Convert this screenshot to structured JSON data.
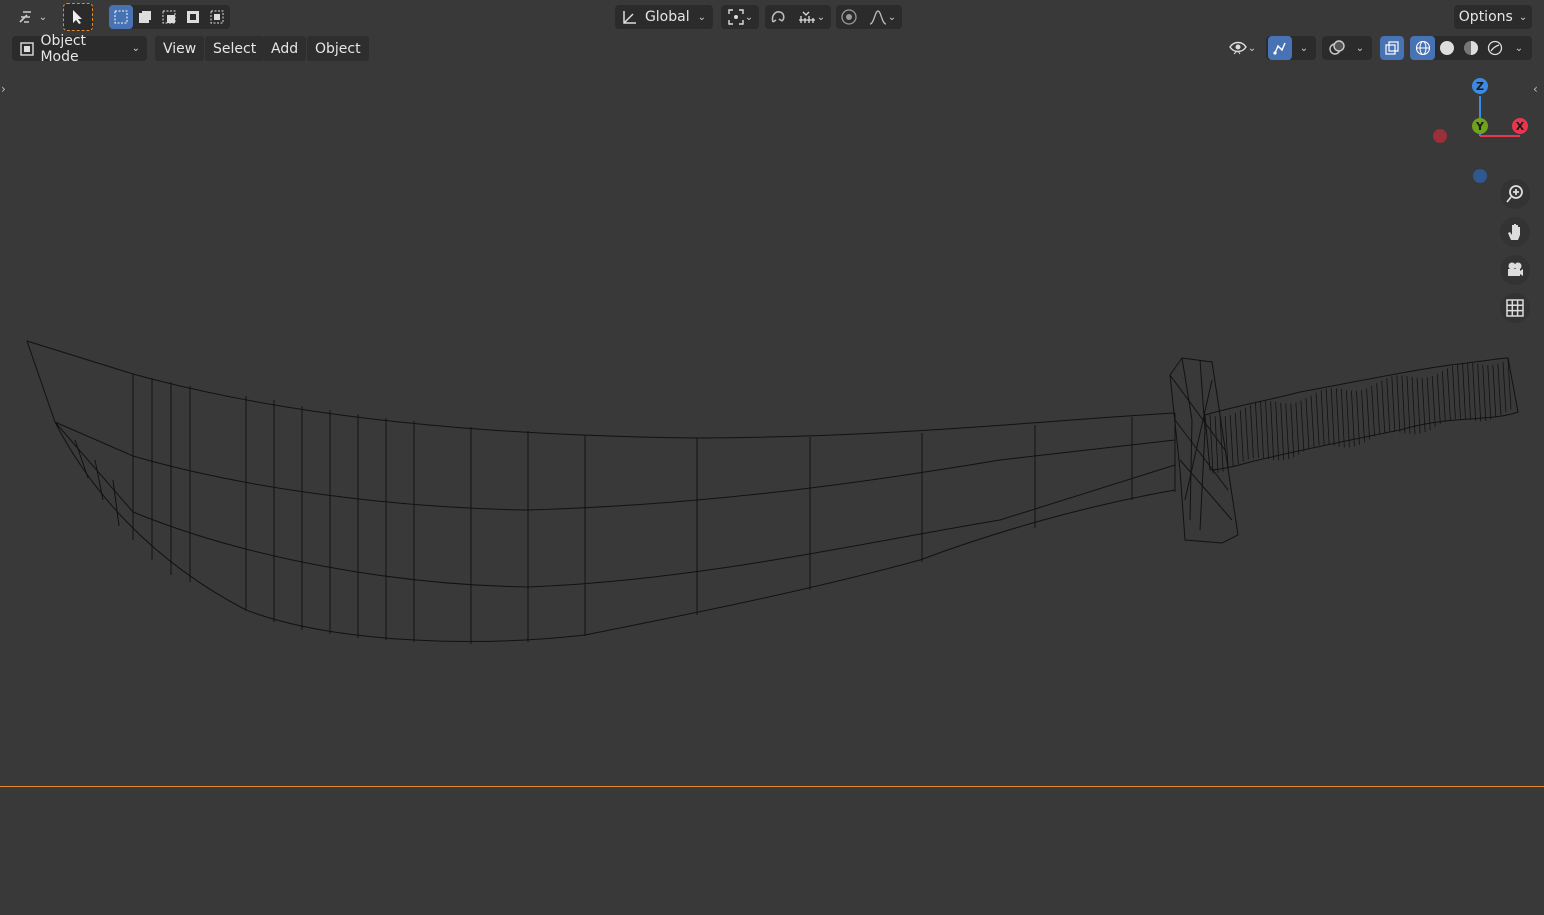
{
  "toolbar": {
    "transform_orientation": "Global",
    "options_label": "Options"
  },
  "header": {
    "mode": "Object Mode",
    "menus": [
      "View",
      "Select",
      "Add",
      "Object"
    ]
  },
  "gizmo": {
    "z_label": "Z",
    "y_label": "Y",
    "x_label": "X"
  },
  "colors": {
    "accent": "#4772b3",
    "timeline_border": "#e08a2d",
    "axis_x": "#e8364f",
    "axis_y": "#6ea31b",
    "axis_z": "#3b8ae3"
  },
  "icons": [
    "editor-type-icon",
    "select-tool-icon",
    "select-mode-new-icon",
    "select-mode-extend-icon",
    "select-mode-subtract-icon",
    "select-mode-difference-icon",
    "select-mode-intersect-icon",
    "orientation-icon",
    "pivot-icon",
    "snap-icon",
    "snap-increment-icon",
    "proportional-edit-icon",
    "falloff-icon",
    "object-mode-icon",
    "visibility-icon",
    "gizmo-icon",
    "overlay-icon",
    "xray-icon",
    "wireframe-shading-icon",
    "solid-shading-icon",
    "material-shading-icon",
    "rendered-shading-icon",
    "zoom-icon",
    "hand-icon",
    "camera-icon",
    "grid-icon"
  ]
}
